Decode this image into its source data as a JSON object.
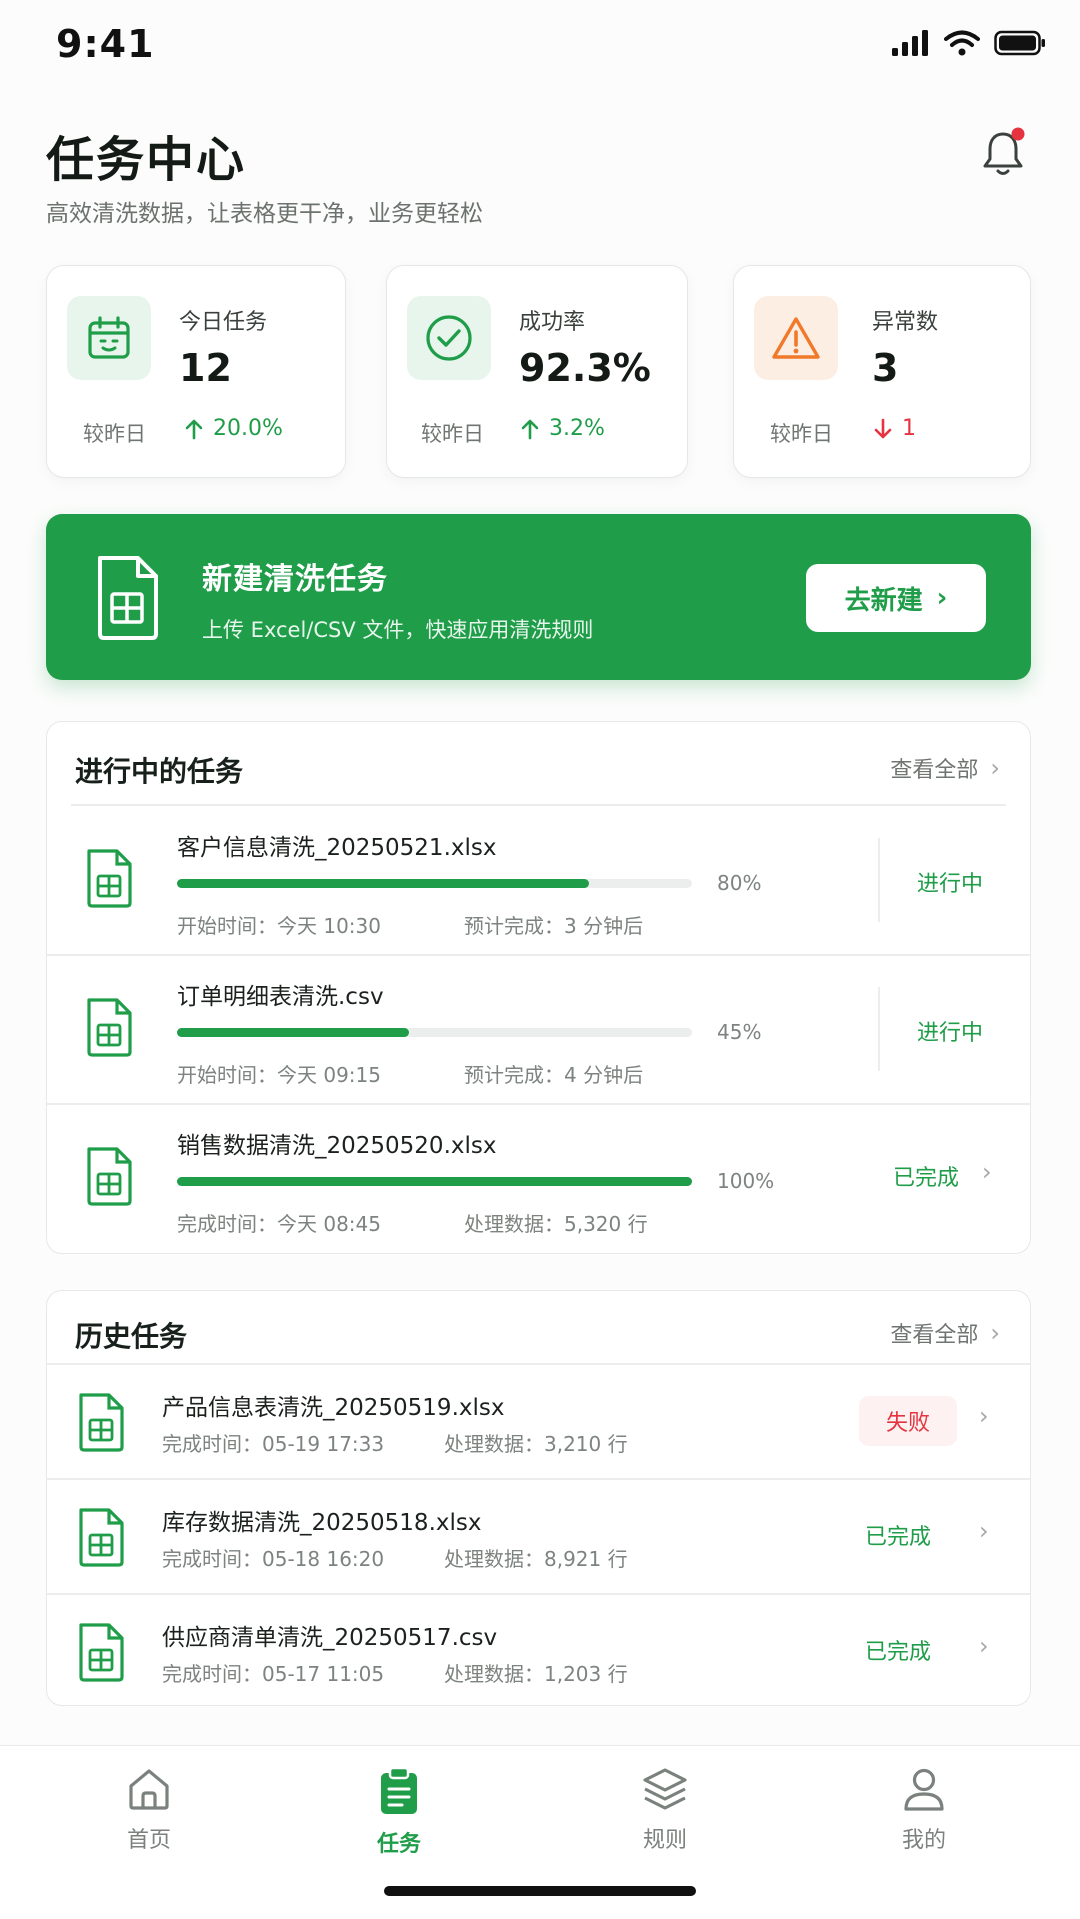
{
  "status_bar": {
    "time": "9:41"
  },
  "header": {
    "title": "任务中心",
    "subtitle": "高效清洗数据，让表格更干净，业务更轻松"
  },
  "stats": [
    {
      "label": "今日任务",
      "value": "12",
      "compare": "较昨日",
      "delta": "20.0%",
      "trend": "up",
      "icon": "calendar-icon"
    },
    {
      "label": "成功率",
      "value": "92.3%",
      "compare": "较昨日",
      "delta": "3.2%",
      "trend": "up",
      "icon": "check-circle-icon"
    },
    {
      "label": "异常数",
      "value": "3",
      "compare": "较昨日",
      "delta": "1",
      "trend": "down",
      "icon": "warning-icon"
    }
  ],
  "banner": {
    "title": "新建清洗任务",
    "desc": "上传 Excel/CSV 文件，快速应用清洗规则",
    "button": "去新建"
  },
  "in_progress": {
    "title": "进行中的任务",
    "view_all": "查看全部",
    "items": [
      {
        "name": "客户信息清洗_20250521.xlsx",
        "progress": 0.8,
        "progress_text": "80%",
        "time": "开始时间：今天 10:30",
        "extra": "预计完成：3 分钟后",
        "status": "进行中"
      },
      {
        "name": "订单明细表清洗.csv",
        "progress": 0.45,
        "progress_text": "45%",
        "time": "开始时间：今天 09:15",
        "extra": "预计完成：4 分钟后",
        "status": "进行中"
      },
      {
        "name": "销售数据清洗_20250520.xlsx",
        "progress": 1.0,
        "progress_text": "100%",
        "time": "完成时间：今天 08:45",
        "extra": "处理数据：5,320 行",
        "status": "已完成"
      }
    ]
  },
  "history": {
    "title": "历史任务",
    "view_all": "查看全部",
    "items": [
      {
        "name": "产品信息表清洗_20250519.xlsx",
        "time": "完成时间：05-19 17:33",
        "extra": "处理数据：3,210 行",
        "status": "失败"
      },
      {
        "name": "库存数据清洗_20250518.xlsx",
        "time": "完成时间：05-18 16:20",
        "extra": "处理数据：8,921 行",
        "status": "已完成"
      },
      {
        "name": "供应商清单清洗_20250517.csv",
        "time": "完成时间：05-17 11:05",
        "extra": "处理数据：1,203 行",
        "status": "已完成"
      }
    ]
  },
  "tabbar": {
    "tabs": [
      {
        "label": "首页",
        "icon": "home-icon",
        "active": false
      },
      {
        "label": "任务",
        "icon": "clipboard-icon",
        "active": true
      },
      {
        "label": "规则",
        "icon": "layers-icon",
        "active": false
      },
      {
        "label": "我的",
        "icon": "user-icon",
        "active": false
      }
    ]
  },
  "colors": {
    "primary": "#1f9d49",
    "danger": "#e5343f",
    "warning": "#f07a2a"
  }
}
